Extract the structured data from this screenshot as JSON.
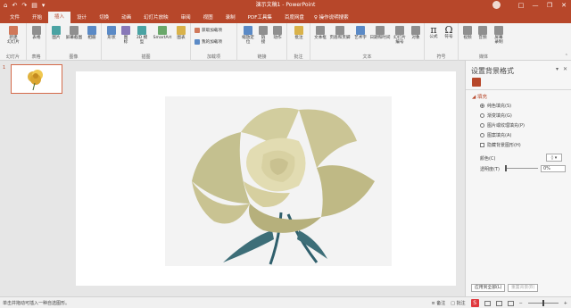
{
  "titlebar": {
    "quick_access": [
      "⌂",
      "↶",
      "↷",
      "▤",
      "▾"
    ],
    "title": "演示文稿1 - PowerPoint",
    "window_controls": [
      "□",
      "—",
      "❐",
      "✕"
    ]
  },
  "tabs": {
    "items": [
      "文件",
      "开始",
      "插入",
      "设计",
      "切换",
      "动画",
      "幻灯片放映",
      "审阅",
      "视图",
      "录制",
      "PDF工具集",
      "百度网盘"
    ],
    "active": "插入",
    "tell_me": "♀ 操作说明搜索"
  },
  "ribbon": {
    "groups": {
      "slides": "幻灯片",
      "tables": "表格",
      "images": "图像",
      "illustrations": "插图",
      "addins": "加载项",
      "links": "链接",
      "comments": "批注",
      "text": "文本",
      "symbols": "符号",
      "media": "媒体"
    },
    "buttons": {
      "new_slide": "新建\n幻灯片",
      "table": "表格",
      "picture": "图片",
      "screenshot": "屏幕截图",
      "album": "相册",
      "shapes": "形状",
      "icons": "图\n标",
      "models_3d": "3D 模\n型",
      "smartart": "SmartArt",
      "chart": "图表",
      "get_addins": "获取加载项",
      "my_addins": "我的加载项",
      "zoom": "缩放定\n位",
      "link": "链\n接",
      "action": "动作",
      "comment": "批注",
      "textbox": "文本框",
      "header_footer": "页眉和页脚",
      "wordart": "艺术字",
      "datetime": "日期和时间",
      "slide_number": "幻灯片\n编号",
      "object": "对象",
      "equation": "公式",
      "symbol": "符号",
      "video": "视频",
      "audio": "音频",
      "screen_record": "屏幕\n录制"
    }
  },
  "thumbnails": {
    "slide_number": "1"
  },
  "format_pane": {
    "title": "设置背景格式",
    "section": "◢ 填充",
    "fill_options": [
      {
        "label": "纯色填充(S)",
        "selected": true
      },
      {
        "label": "渐变填充(G)",
        "selected": false
      },
      {
        "label": "图片或纹理填充(P)",
        "selected": false
      },
      {
        "label": "图案填充(A)",
        "selected": false
      }
    ],
    "hide_background": "隐藏背景图形(H)",
    "color_label": "颜色(C)",
    "transparency_label": "透明度(T)",
    "transparency_value": "0%",
    "apply_all": "应用到全部(L)",
    "reset": "重置背景(B)"
  },
  "status": {
    "left": "单击并拖动可插入一种自选图形。",
    "notes": "≡ 备注",
    "comments": "□ 批注"
  },
  "colors": {
    "accent": "#b7472a"
  }
}
